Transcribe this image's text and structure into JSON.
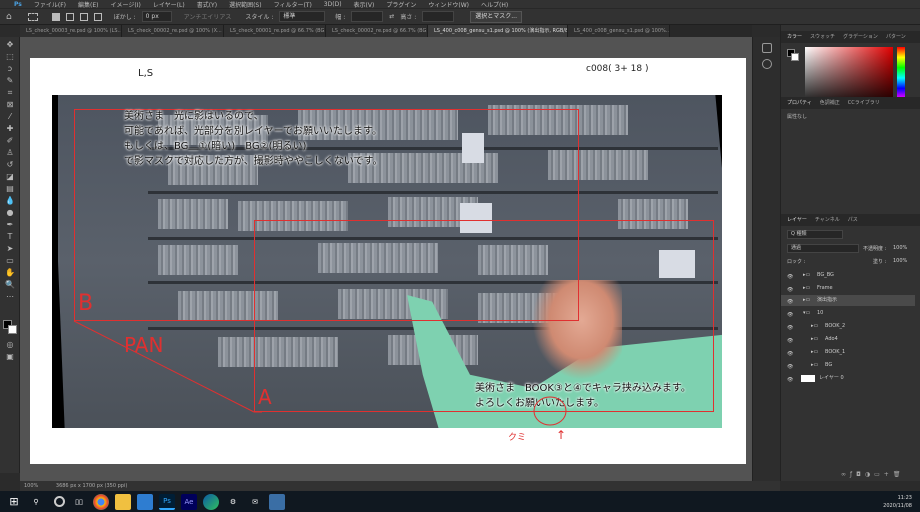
{
  "menubar": {
    "items": [
      "ファイル(F)",
      "編集(E)",
      "イメージ(I)",
      "レイヤー(L)",
      "書式(Y)",
      "選択範囲(S)",
      "フィルター(T)",
      "3D(D)",
      "表示(V)",
      "プラグイン",
      "ウィンドウ(W)",
      "ヘルプ(H)"
    ]
  },
  "options": {
    "feather_label": "ぼかし :",
    "feather_value": "0 px",
    "antialias_label": "アンチエイリアス",
    "style_label": "スタイル :",
    "style_value": "標準",
    "width_label": "幅 :",
    "height_label": "高さ :",
    "select_mask_button": "選択とマスク..."
  },
  "tabs": [
    {
      "label": "LS_check_00003_re.psd @ 100% (LS..."
    },
    {
      "label": "LS_check_00002_re.psd @ 100% (X..."
    },
    {
      "label": "LS_check_00001_re.psd @ 66.7% (BG..."
    },
    {
      "label": "LS_check_00002_re.psd @ 66.7% (BG..."
    },
    {
      "label": "LS_400_c008_gensu_s1.psd @ 100% (演出指示, RGB/8)"
    },
    {
      "label": "LS_400_c008_gensu_s1.psd @ 100%..."
    }
  ],
  "canvas": {
    "top_left_label": "L,S",
    "top_right_label": "c008( 3+ 18 )",
    "note_top": [
      "美術さま　光に影はいるので、",
      "可能であれば、光部分を別レイヤーでお願いいたします。",
      "もしくは、BG＿①(暗い)　BG②(明るい)",
      "で影マスクで対応した方が、撮影時ややこしくないです。"
    ],
    "note_bottom": [
      "美術さま　BOOK③と④でキャラ挟み込みます。",
      "よろしくお願いいたします。"
    ],
    "label_b": "B",
    "label_pan": "PAN",
    "label_a": "A",
    "label_kumi": "クミ",
    "label_arrow": "↑"
  },
  "panels": {
    "color_tabs": [
      "カラー",
      "スウォッチ",
      "グラデーション",
      "パターン"
    ],
    "props_tabs": [
      "プロパティ",
      "色調補正",
      "CCライブラリ"
    ],
    "props_text": "属性なし",
    "layers_tabs": [
      "レイヤー",
      "チャンネル",
      "パス"
    ],
    "kind_label": "Q 種類",
    "blend_mode": "通過",
    "opacity_label": "不透明度 :",
    "opacity_value": "100%",
    "lock_label": "ロック :",
    "fill_label": "塗り :",
    "fill_value": "100%",
    "layers": [
      {
        "name": "BG_BG"
      },
      {
        "name": "Frame"
      },
      {
        "name": "演出指示"
      },
      {
        "name": "10"
      },
      {
        "name": "BOOK_2"
      },
      {
        "name": "Ado4"
      },
      {
        "name": "BOOK_1"
      },
      {
        "name": "BG"
      },
      {
        "name": "レイヤー 0"
      }
    ]
  },
  "status": {
    "zoom": "100%",
    "doc_size": "3686 px x 1700 px (350 ppi)"
  },
  "taskbar": {
    "time": "11:23",
    "date": "2020/11/08"
  },
  "colors": {
    "red_annotation": "#e03030",
    "ui_dark": "#323232",
    "canvas_bg": "#535353",
    "mask_green": "#7ed1b0"
  }
}
